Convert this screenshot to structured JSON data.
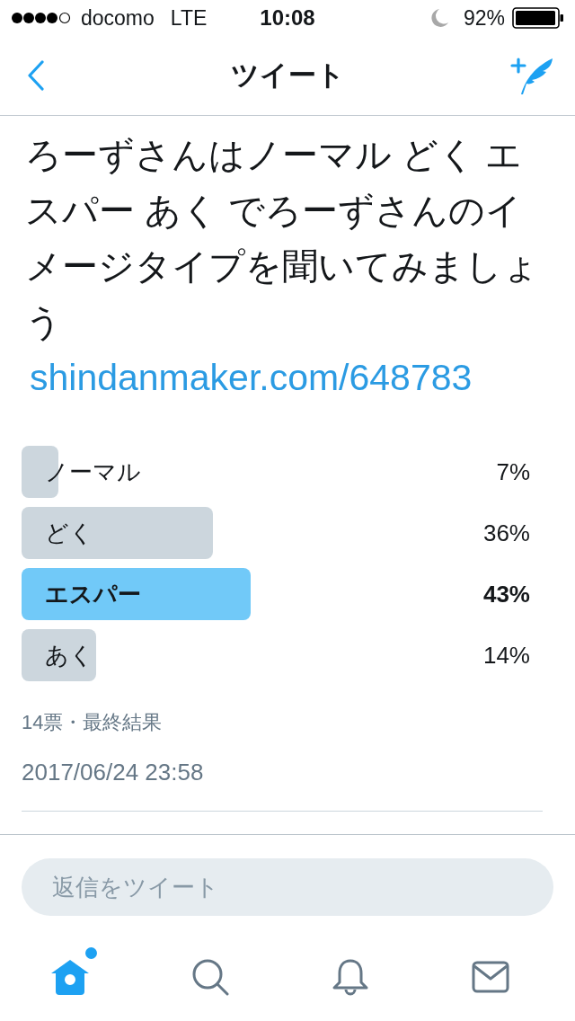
{
  "status_bar": {
    "carrier": "docomo",
    "network": "LTE",
    "time": "10:08",
    "battery": "92%"
  },
  "nav": {
    "title": "ツイート"
  },
  "tweet": {
    "text": "ろーずさんはノーマル どく エスパー あく でろーずさんのイメージタイプを聞いてみましょう",
    "link": "shindanmaker.com/648783"
  },
  "poll": {
    "options": [
      {
        "label": "ノーマル",
        "percent": "7%",
        "level": 0.07,
        "winner": false
      },
      {
        "label": "どく",
        "percent": "36%",
        "level": 0.36,
        "winner": false
      },
      {
        "label": "エスパー",
        "percent": "43%",
        "level": 0.43,
        "winner": true
      },
      {
        "label": "あく",
        "percent": "14%",
        "level": 0.14,
        "winner": false
      }
    ],
    "summary": "14票・最終結果"
  },
  "timestamp": "2017/06/24 23:58",
  "reply": {
    "placeholder": "返信をツイート"
  },
  "tab_bar": [
    {
      "kind": "home",
      "selected": true,
      "badge": true
    },
    {
      "kind": "search",
      "selected": false,
      "badge": false
    },
    {
      "kind": "notifications",
      "selected": false,
      "badge": false
    },
    {
      "kind": "messages",
      "selected": false,
      "badge": false
    }
  ]
}
